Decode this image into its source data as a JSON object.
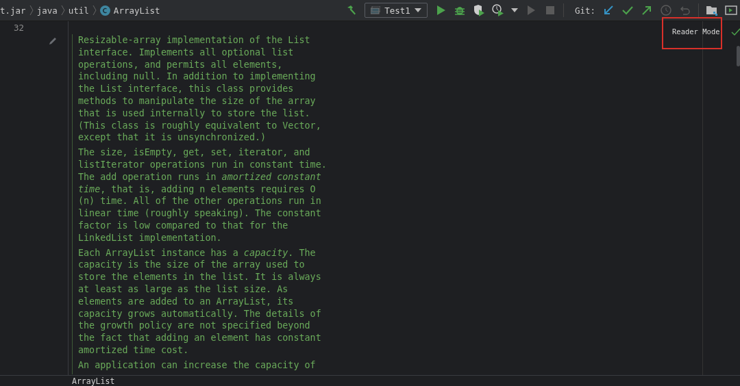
{
  "breadcrumbs": [
    {
      "label": "t.jar",
      "kind": "text"
    },
    {
      "label": "java",
      "kind": "text"
    },
    {
      "label": "util",
      "kind": "text"
    },
    {
      "label": "ArrayList",
      "kind": "class"
    }
  ],
  "toolbar": {
    "run_config": "Test1",
    "git_label": "Git:"
  },
  "editor": {
    "line_number": "32",
    "reader_mode": "Reader Mode",
    "highlighted": true,
    "paragraphs": [
      [
        "Resizable-array implementation of the List",
        "interface. Implements all optional list",
        "operations, and permits all elements,",
        "including null. In addition to implementing",
        "the List interface, this class provides",
        "methods to manipulate the size of the array",
        "that is used internally to store the list.",
        "(This class is roughly equivalent to Vector,",
        "except that it is unsynchronized.)"
      ],
      [
        "The size, isEmpty, get, set, iterator, and",
        "listIterator operations run in constant time.",
        "The add operation runs in *amortized constant*",
        "*time*, that is, adding n elements requires O",
        "(n) time. All of the other operations run in",
        "linear time (roughly speaking). The constant",
        "factor is low compared to that for the",
        "LinkedList implementation."
      ],
      [
        "Each ArrayList instance has a *capacity*. The",
        "capacity is the size of the array used to",
        "store the elements in the list. It is always",
        "at least as large as the list size. As",
        "elements are added to an ArrayList, its",
        "capacity grows automatically. The details of",
        "the growth policy are not specified beyond",
        "the fact that adding an element has constant",
        "amortized time cost."
      ],
      [
        "An application can increase the capacity of"
      ]
    ]
  },
  "status_bar": {
    "text": "ArrayList"
  }
}
